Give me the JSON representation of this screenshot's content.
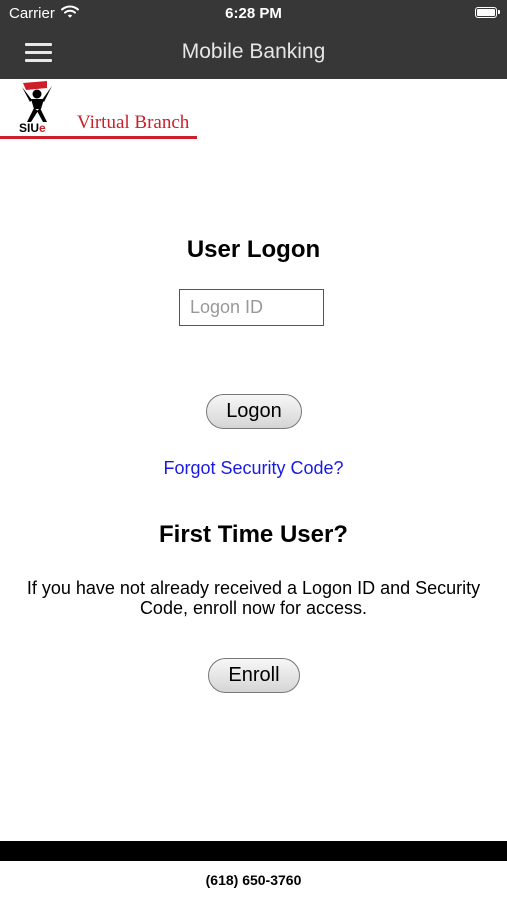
{
  "status_bar": {
    "carrier": "Carrier",
    "time": "6:28 PM",
    "wifi_icon": "wifi-icon",
    "battery_icon": "battery-icon"
  },
  "nav": {
    "title": "Mobile Banking",
    "menu_icon": "hamburger-menu-icon"
  },
  "logo": {
    "mascot_text": "SIU",
    "mascot_accent": "e",
    "branch_text": "Virtual Branch",
    "accent_color": "#cc1f2a"
  },
  "logon": {
    "heading": "User Logon",
    "input_placeholder": "Logon ID",
    "input_value": "",
    "button_label": "Logon",
    "forgot_link": "Forgot Security Code?",
    "link_color": "#1a1ae6"
  },
  "enroll": {
    "heading": "First Time User?",
    "description": "If you have not already received a Logon ID and Security Code, enroll now for access.",
    "button_label": "Enroll"
  },
  "footer": {
    "phone": "(618) 650-3760"
  },
  "colors": {
    "bar_background": "#373737",
    "footer_bar": "#000000"
  }
}
